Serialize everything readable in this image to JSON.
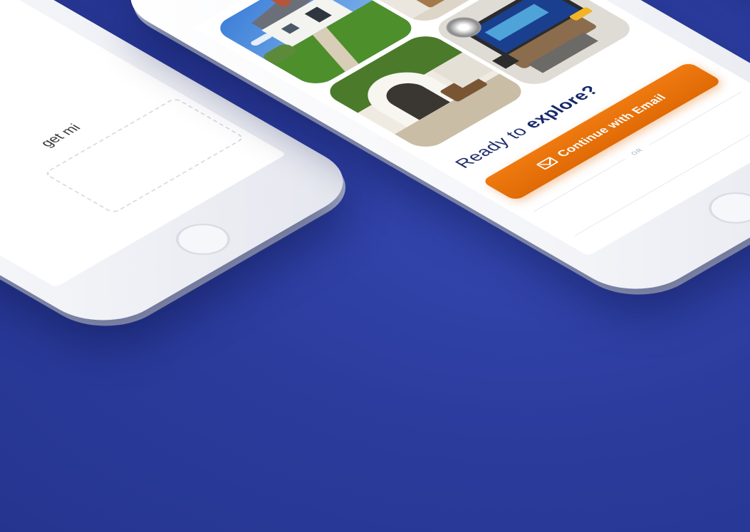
{
  "main_screen": {
    "headline_prefix": "Ready to ",
    "headline_emphasis": "explore?",
    "cta_label": "Continue with Email",
    "divider_label": "OR",
    "photos": [
      "house exterior",
      "interior living room",
      "patio courtyard",
      "bedroom"
    ]
  },
  "left_screen": {
    "partial_text": "get mi"
  },
  "top_screen": {
    "partial_button": "+"
  },
  "colors": {
    "background": "#2c3c9e",
    "cta_orange": "#e8720a",
    "headline_navy": "#1d2b6b",
    "accent_coral": "#f2693a"
  },
  "icons": [
    "mail-icon",
    "home-button-icon"
  ]
}
